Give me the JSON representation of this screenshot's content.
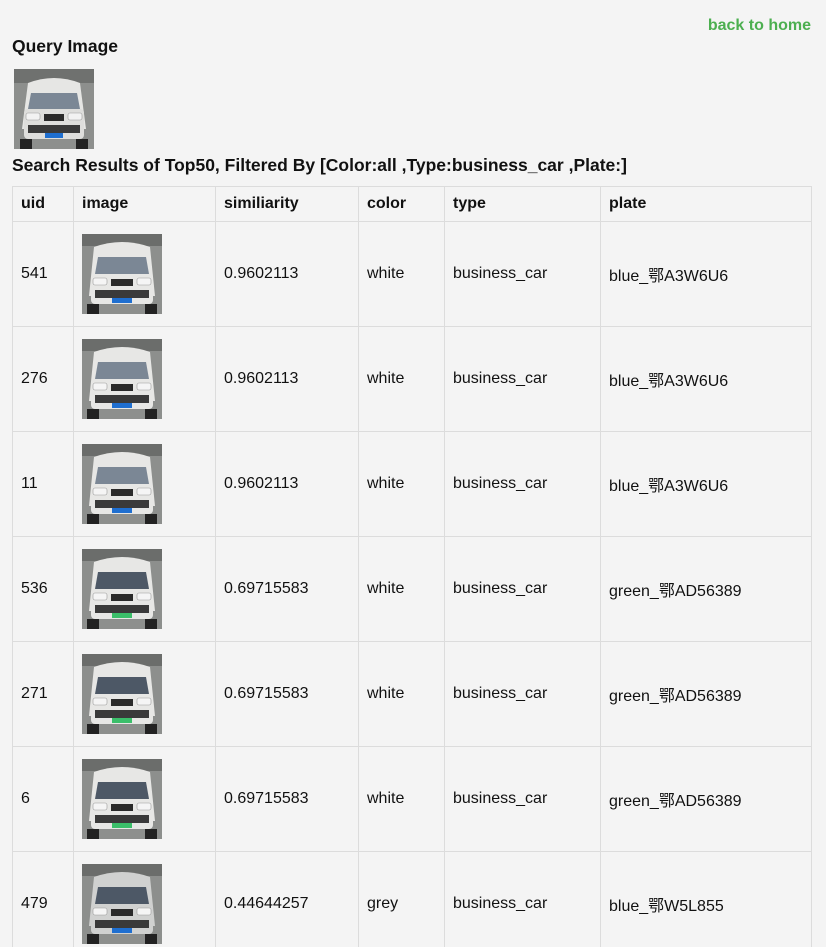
{
  "nav": {
    "back_label": "back to home"
  },
  "query": {
    "heading": "Query Image"
  },
  "results": {
    "heading": "Search Results of Top50, Filtered By [Color:all ,Type:business_car ,Plate:]",
    "columns": [
      "uid",
      "image",
      "similiarity",
      "color",
      "type",
      "plate"
    ],
    "rows": [
      {
        "uid": "541",
        "similarity": "0.9602113",
        "color": "white",
        "type": "business_car",
        "plate": "blue_鄂A3W6U6"
      },
      {
        "uid": "276",
        "similarity": "0.9602113",
        "color": "white",
        "type": "business_car",
        "plate": "blue_鄂A3W6U6"
      },
      {
        "uid": "11",
        "similarity": "0.9602113",
        "color": "white",
        "type": "business_car",
        "plate": "blue_鄂A3W6U6"
      },
      {
        "uid": "536",
        "similarity": "0.69715583",
        "color": "white",
        "type": "business_car",
        "plate": "green_鄂AD56389"
      },
      {
        "uid": "271",
        "similarity": "0.69715583",
        "color": "white",
        "type": "business_car",
        "plate": "green_鄂AD56389"
      },
      {
        "uid": "6",
        "similarity": "0.69715583",
        "color": "white",
        "type": "business_car",
        "plate": "green_鄂AD56389"
      },
      {
        "uid": "479",
        "similarity": "0.44644257",
        "color": "grey",
        "type": "business_car",
        "plate": "blue_鄂W5L855"
      }
    ]
  },
  "colors": {
    "link": "#4caf50",
    "background": "#f4f4f4",
    "border": "#dcdcdc",
    "plate_blue": "#1f6fd0",
    "plate_green": "#3bbf6a"
  }
}
